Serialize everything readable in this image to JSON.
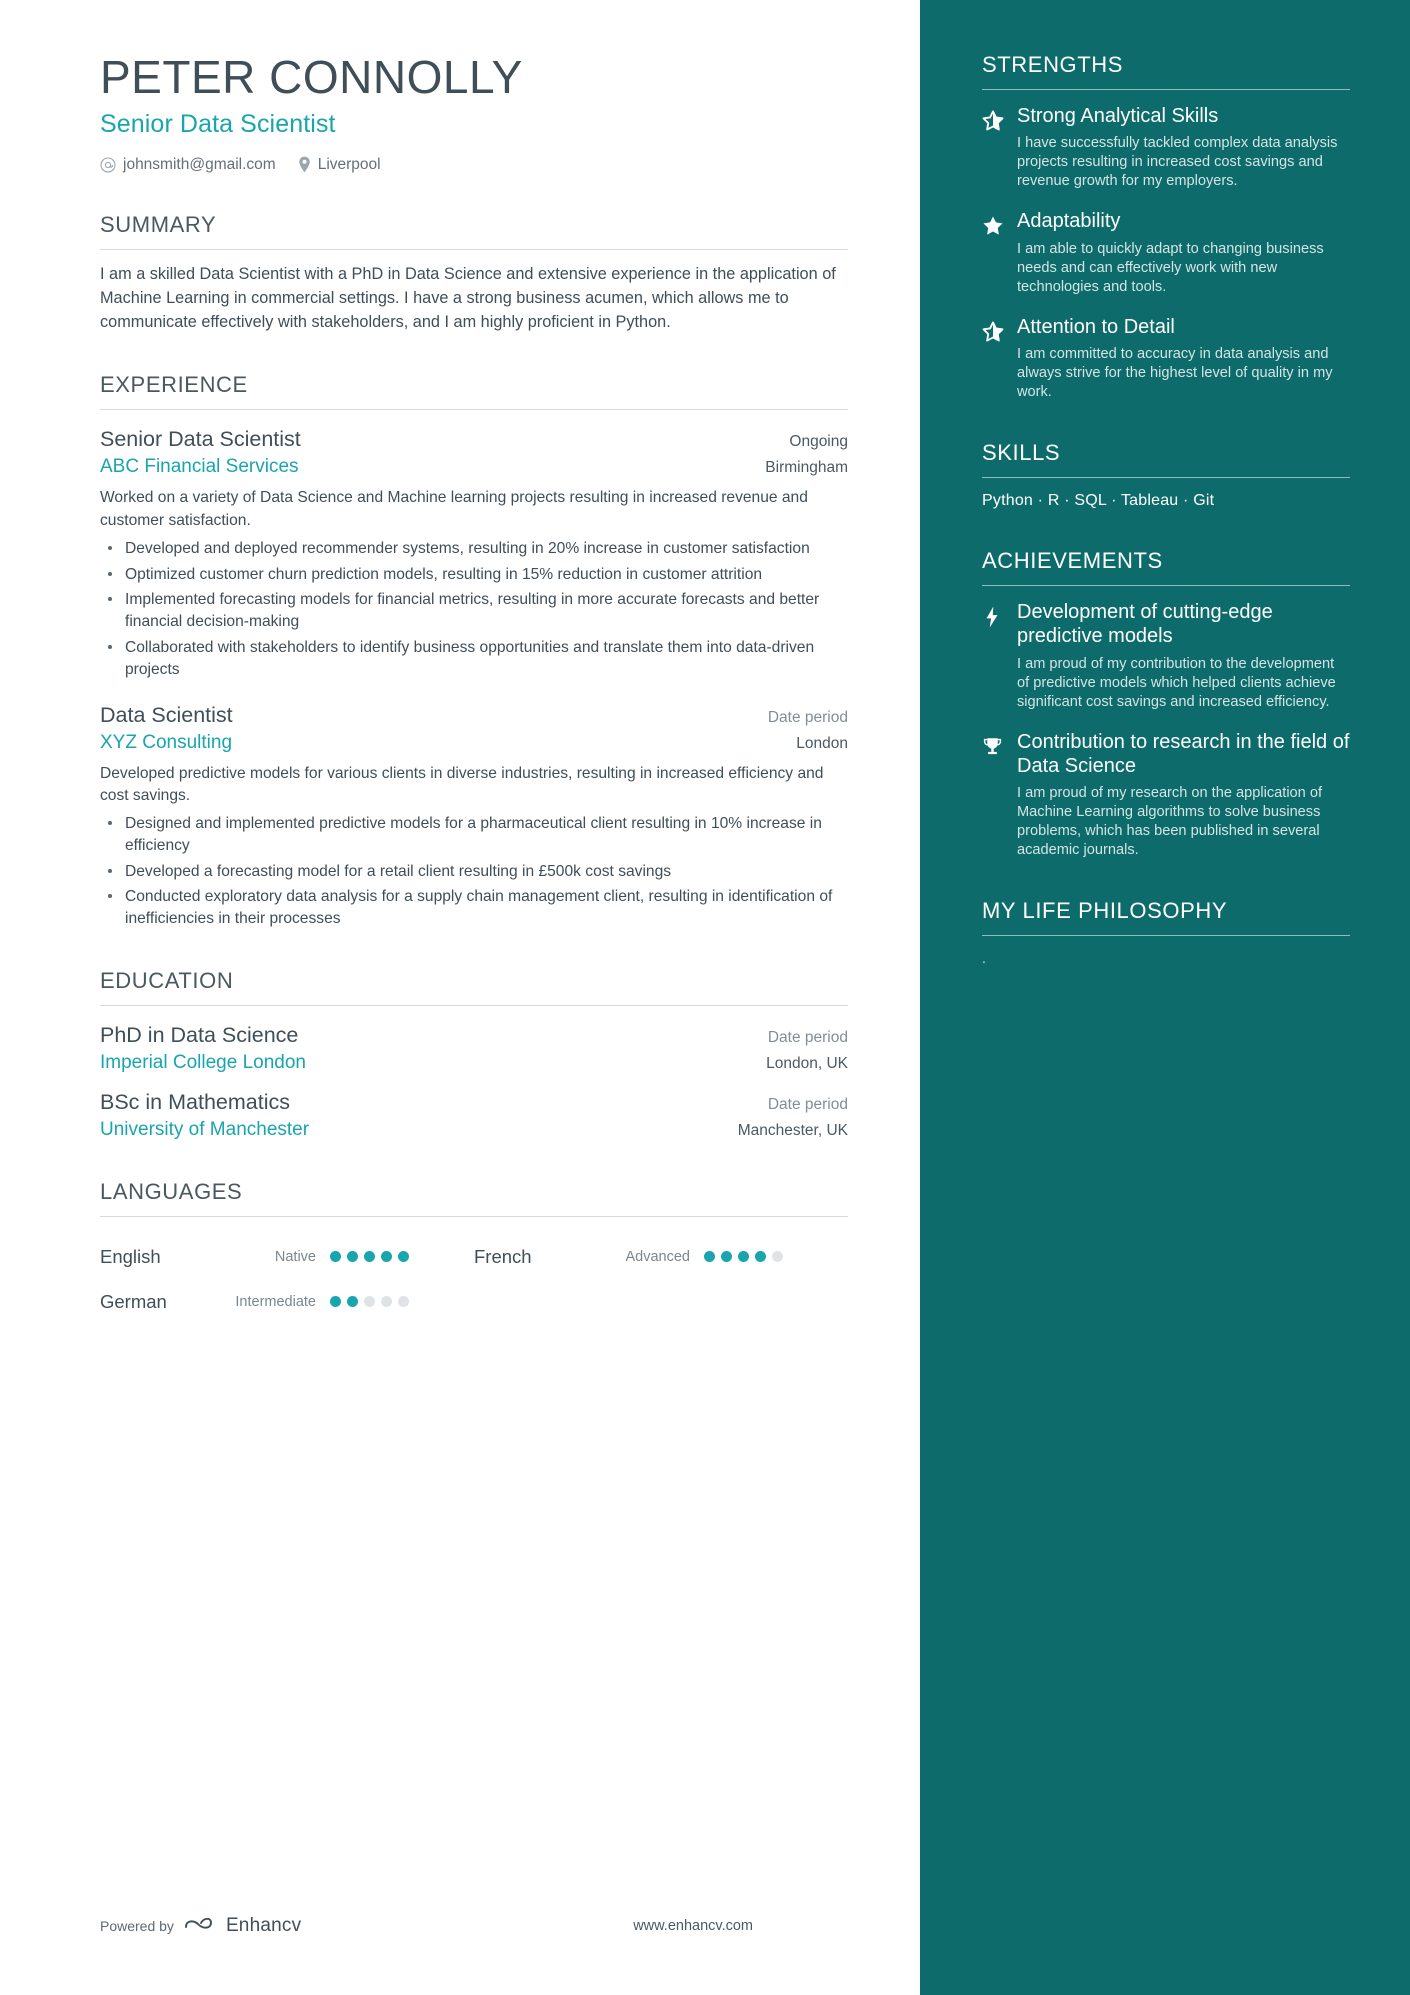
{
  "header": {
    "name": "PETER CONNOLLY",
    "job_title": "Senior Data Scientist",
    "email": "johnsmith@gmail.com",
    "location": "Liverpool"
  },
  "colors": {
    "accent_teal": "#19a5ae",
    "sidebar_bg": "#0d6b6b",
    "text_dark": "#3f4e57",
    "text_muted": "#828e96"
  },
  "summary": {
    "heading": "SUMMARY",
    "text": "I am a skilled Data Scientist with a PhD in Data Science and extensive experience in the application of Machine Learning in commercial settings. I have a strong business acumen, which allows me to communicate effectively with stakeholders, and I am highly proficient in Python."
  },
  "experience": {
    "heading": "EXPERIENCE",
    "entries": [
      {
        "title": "Senior Data Scientist",
        "date": "Ongoing",
        "organization": "ABC Financial Services",
        "location": "Birmingham",
        "description": "Worked on a variety of Data Science and Machine learning projects resulting in increased revenue and customer satisfaction.",
        "bullets": [
          "Developed and deployed recommender systems, resulting in 20% increase in customer satisfaction",
          "Optimized customer churn prediction models, resulting in 15% reduction in customer attrition",
          "Implemented forecasting models for financial metrics, resulting in more accurate forecasts and better financial decision-making",
          "Collaborated with stakeholders to identify business opportunities and translate them into data-driven projects"
        ]
      },
      {
        "title": "Data Scientist",
        "date": "Date period",
        "organization": "XYZ Consulting",
        "location": "London",
        "description": "Developed predictive models for various clients in diverse industries, resulting in increased efficiency and cost savings.",
        "bullets": [
          "Designed and implemented predictive models for a pharmaceutical client resulting in 10% increase in efficiency",
          "Developed a forecasting model for a retail client resulting in £500k cost savings",
          "Conducted exploratory data analysis for a supply chain management client, resulting in identification of inefficiencies in their processes"
        ]
      }
    ]
  },
  "education": {
    "heading": "EDUCATION",
    "entries": [
      {
        "title": "PhD in Data Science",
        "date": "Date period",
        "organization": "Imperial College London",
        "location": "London, UK"
      },
      {
        "title": "BSc in Mathematics",
        "date": "Date period",
        "organization": "University of Manchester",
        "location": "Manchester, UK"
      }
    ]
  },
  "languages": {
    "heading": "LANGUAGES",
    "items": [
      {
        "name": "English",
        "level": "Native",
        "filled": 5,
        "total": 5
      },
      {
        "name": "French",
        "level": "Advanced",
        "filled": 4,
        "total": 5
      },
      {
        "name": "German",
        "level": "Intermediate",
        "filled": 2,
        "total": 5
      }
    ]
  },
  "strengths": {
    "heading": "STRENGTHS",
    "items": [
      {
        "icon": "star-half-icon",
        "title": "Strong Analytical Skills",
        "text": "I have successfully tackled complex data analysis projects resulting in increased cost savings and revenue growth for my employers."
      },
      {
        "icon": "star-filled-icon",
        "title": "Adaptability",
        "text": "I am able to quickly adapt to changing business needs and can effectively work with new technologies and tools."
      },
      {
        "icon": "star-half-icon",
        "title": "Attention to Detail",
        "text": "I am committed to accuracy in data analysis and always strive for the highest level of quality in my work."
      }
    ]
  },
  "skills": {
    "heading": "SKILLS",
    "list": "Python ·   R  · SQL · Tableau · Git"
  },
  "achievements": {
    "heading": "ACHIEVEMENTS",
    "items": [
      {
        "icon": "lightning-bolt-icon",
        "title": "Development of cutting-edge predictive models",
        "text": "I am proud of my contribution to the development of predictive models which helped clients achieve significant cost savings and increased efficiency."
      },
      {
        "icon": "trophy-icon",
        "title": "Contribution to research in the field of Data Science",
        "text": "I am proud of my research on the application of Machine Learning algorithms to solve business problems, which has been published in several academic journals."
      }
    ]
  },
  "philosophy": {
    "heading": "MY LIFE PHILOSOPHY",
    "text": "."
  },
  "footer": {
    "powered_by": "Powered by",
    "brand": "Enhancv",
    "site": "www.enhancv.com"
  }
}
